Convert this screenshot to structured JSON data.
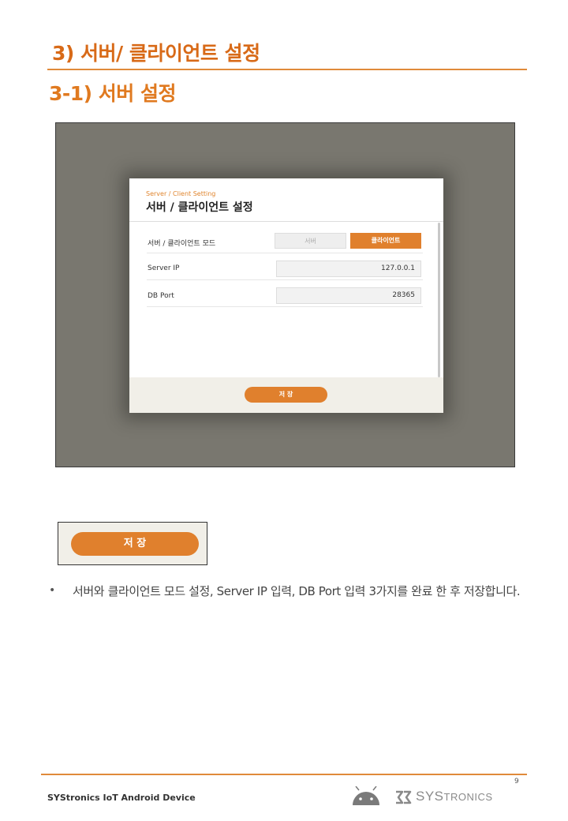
{
  "section_title": "3) 서버/ 클라이언트 설정",
  "subsection_title": "3-1)  서버 설정",
  "dialog": {
    "subtitle": "Server / Client Setting",
    "title": "서버 / 클라이언트 설정",
    "rows": [
      {
        "label": "서버 / 클라이언트 모드"
      },
      {
        "label": "Server IP",
        "value": "127.0.0.1"
      },
      {
        "label": "DB Port",
        "value": "28365"
      }
    ],
    "mode_options": [
      "서버",
      "클라이언트"
    ],
    "selected_mode": "클라이언트",
    "save_label": "저 장"
  },
  "zoom_save_label": "저 장",
  "bullet": {
    "marker": "•",
    "text": "서버와 클라이언트 모드 설정, Server IP 입력, DB Port 입력 3가지를 완료 한 후 저장합니다."
  },
  "footer": {
    "page_number": "9",
    "company_line": "SYStronics IoT Android Device",
    "logo_big1": "SYS",
    "logo_small": "TRONICS"
  },
  "colors": {
    "accent": "#e0802d",
    "title": "#d86a18",
    "backdrop": "#79776f"
  },
  "icons": [
    "android-icon",
    "systronics-logo-icon"
  ]
}
